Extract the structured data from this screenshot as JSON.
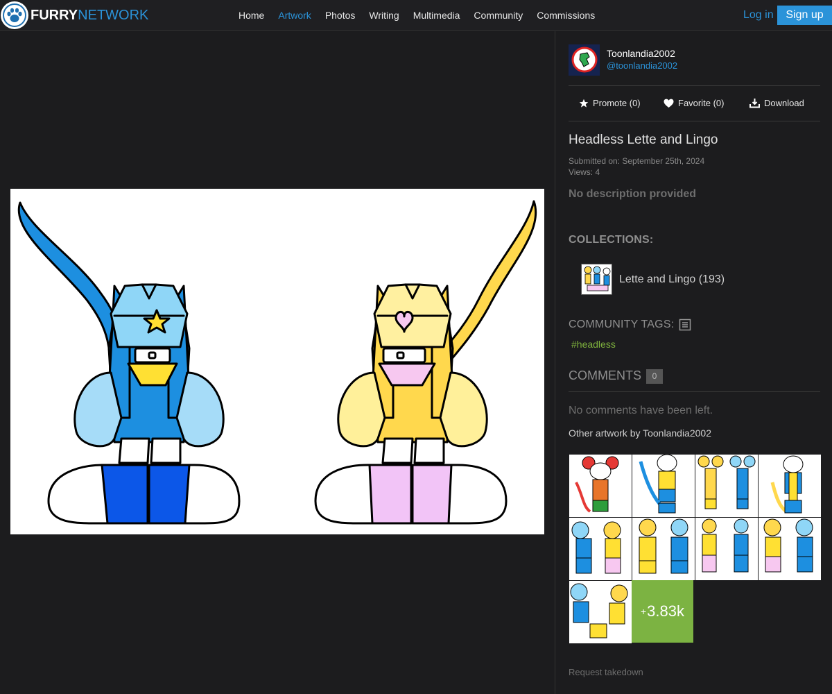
{
  "brand": {
    "word1": "FURRY",
    "word2": "NETWORK"
  },
  "nav": {
    "links": [
      {
        "label": "Home",
        "active": false
      },
      {
        "label": "Artwork",
        "active": true
      },
      {
        "label": "Photos",
        "active": false
      },
      {
        "label": "Writing",
        "active": false
      },
      {
        "label": "Multimedia",
        "active": false
      },
      {
        "label": "Community",
        "active": false
      },
      {
        "label": "Commissions",
        "active": false
      }
    ],
    "login": "Log in",
    "signup": "Sign up"
  },
  "author": {
    "name": "Toonlandia2002",
    "handle": "@toonlandia2002"
  },
  "actions": {
    "promote": "Promote (0)",
    "favorite": "Favorite (0)",
    "download": "Download"
  },
  "artwork": {
    "title": "Headless Lette and Lingo",
    "submitted": "Submitted on: September 25th, 2024",
    "views": "Views: 4",
    "description": "No description provided"
  },
  "collections": {
    "heading": "COLLECTIONS:",
    "items": [
      {
        "label": "Lette and Lingo (193)"
      }
    ]
  },
  "tags": {
    "heading": "COMMUNITY TAGS:",
    "items": [
      "#headless"
    ]
  },
  "comments": {
    "heading": "COMMENTS",
    "count": "0",
    "empty": "No comments have been left."
  },
  "other": {
    "heading": "Other artwork by Toonlandia2002",
    "more_prefix": "+",
    "more_count": "3.83k"
  },
  "footer": {
    "takedown": "Request takedown"
  },
  "colors": {
    "accent": "#2b93d9",
    "tag": "#7fb33d",
    "more_tile": "#7cb342",
    "background": "#1c1c1e"
  }
}
